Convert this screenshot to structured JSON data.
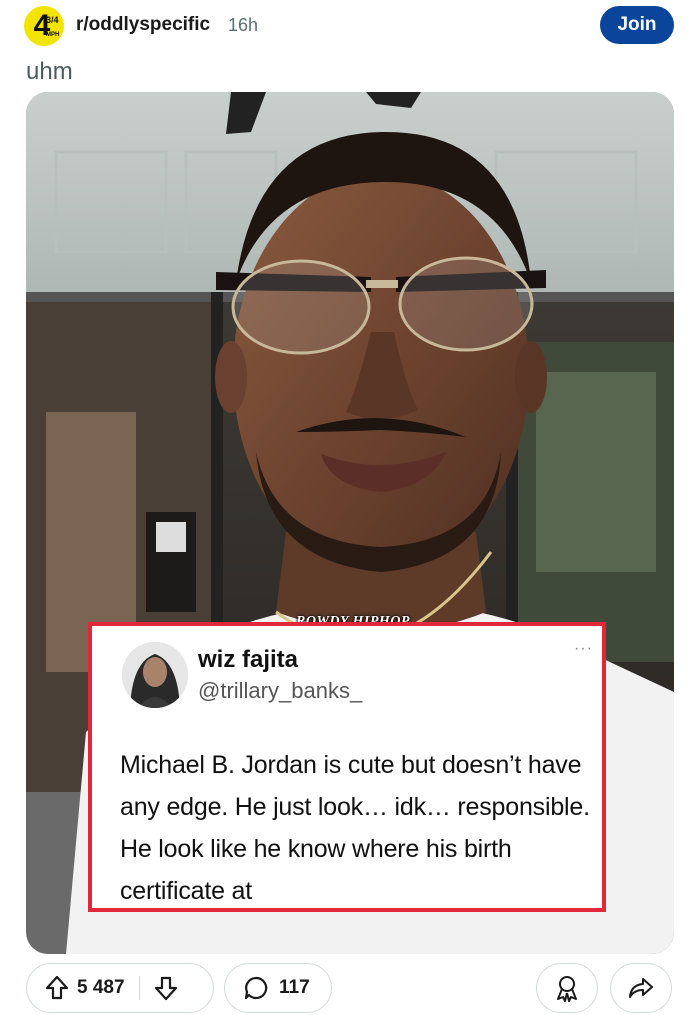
{
  "header": {
    "subreddit": "r/oddlyspecific",
    "age": "16h",
    "join_label": "Join",
    "avatar": {
      "big": "4",
      "fraction": "3/4",
      "unit": "MPH"
    },
    "accent": "#0a449b"
  },
  "post": {
    "title": "uhm",
    "watermark": "ROWDY HIPHOP",
    "tweet": {
      "name": "wiz fajita",
      "handle": "@trillary_banks_",
      "more": "···",
      "text": "Michael B. Jordan is cute but doesn’t have any edge. He just look… idk… responsible. He look like he know where his birth certificate at",
      "border_color": "#e0283a"
    }
  },
  "actions": {
    "upvote_icon": "arrow-up-icon",
    "score": "5 487",
    "downvote_icon": "arrow-down-icon",
    "comment_icon": "comment-bubble-icon",
    "comments": "117",
    "award_icon": "award-icon",
    "share_icon": "share-icon"
  }
}
